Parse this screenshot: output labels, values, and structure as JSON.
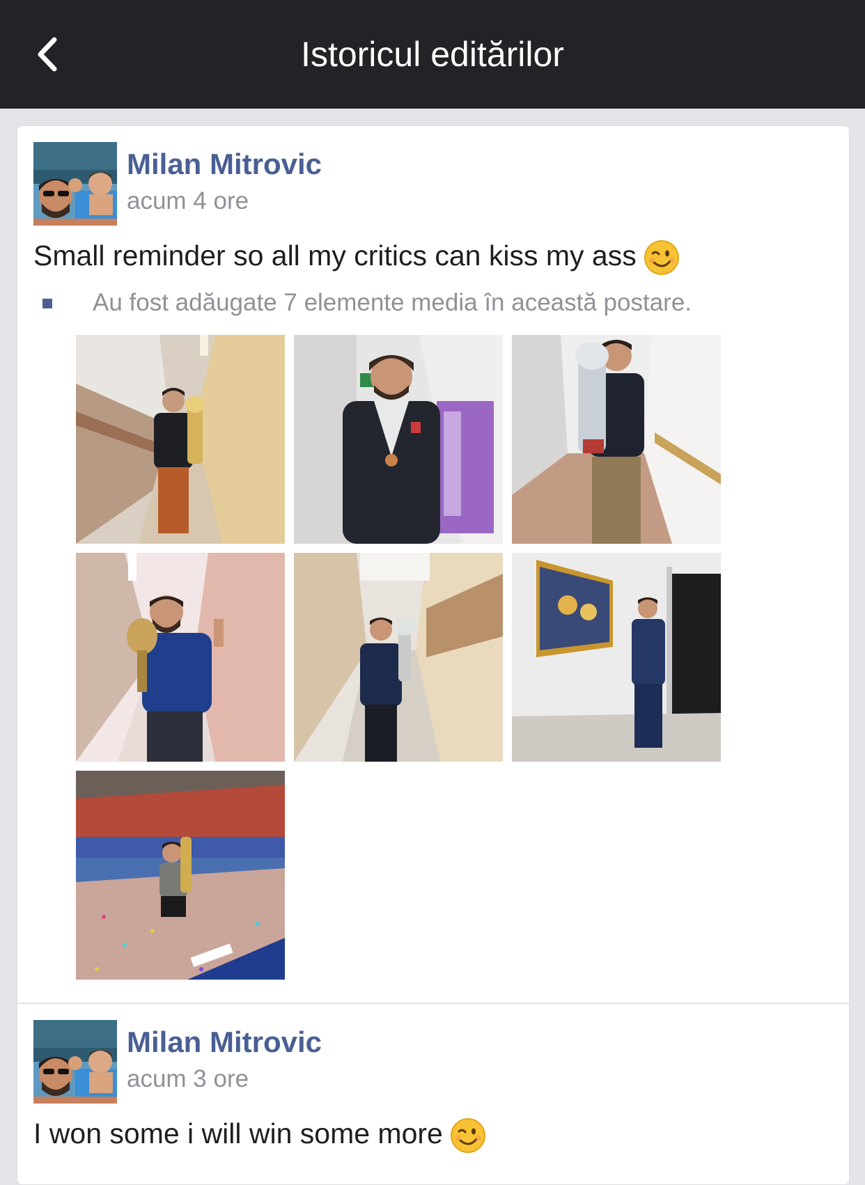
{
  "header": {
    "title": "Istoricul editărilor",
    "back_icon": "chevron-left-icon"
  },
  "colors": {
    "header_bg": "#222326",
    "page_bg": "#e4e5e9",
    "author_link": "#4a5f93",
    "meta_text": "#8e9197",
    "body_text": "#1c1e21"
  },
  "entries": [
    {
      "author": "Milan Mitrovic",
      "time": "acum 4 ore",
      "text": "Small reminder so all my critics can kiss my ass",
      "emoji": "winking-face",
      "media_note": "Au fost adăugate 7 elemente media în această postare.",
      "media_count": 7
    },
    {
      "author": "Milan Mitrovic",
      "time": "acum 3 ore",
      "text": "I won some i will win some more",
      "emoji": "winking-face"
    }
  ]
}
